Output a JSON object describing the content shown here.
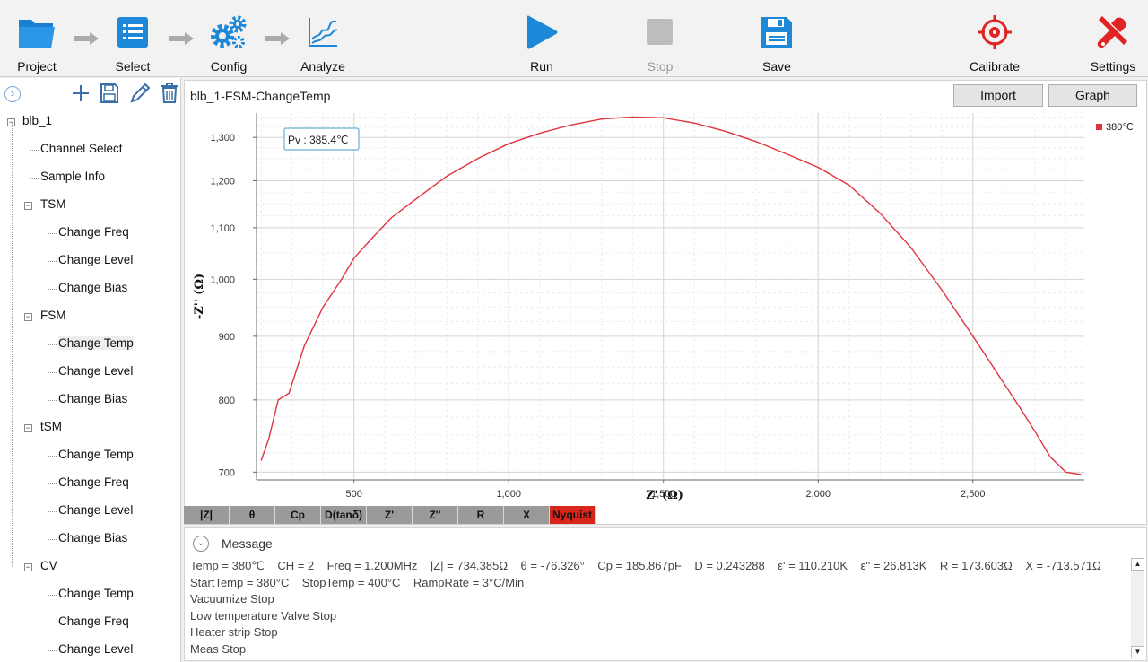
{
  "toolbar": {
    "project": "Project",
    "select": "Select",
    "config": "Config",
    "analyze": "Analyze",
    "run": "Run",
    "stop": "Stop",
    "save": "Save",
    "calibrate": "Calibrate",
    "settings": "Settings"
  },
  "tree": {
    "root": "blb_1",
    "channel_select": "Channel Select",
    "sample_info": "Sample Info",
    "groups": [
      {
        "label": "TSM",
        "items": [
          "Change Freq",
          "Change Level",
          "Change Bias"
        ]
      },
      {
        "label": "FSM",
        "items": [
          "Change Temp",
          "Change Level",
          "Change Bias"
        ]
      },
      {
        "label": "tSM",
        "items": [
          "Change Temp",
          "Change Freq",
          "Change Level",
          "Change Bias"
        ]
      },
      {
        "label": "CV",
        "items": [
          "Change Temp",
          "Change Freq",
          "Change Level"
        ]
      }
    ]
  },
  "graph": {
    "title": "blb_1-FSM-ChangeTemp",
    "import": "Import",
    "graph_btn": "Graph",
    "pv_label": "Pv :  385.4℃"
  },
  "tabs": [
    "|Z|",
    "θ",
    "Cp",
    "D(tanδ)",
    "Z'",
    "Z''",
    "R",
    "X",
    "Nyquist"
  ],
  "message": {
    "title": "Message",
    "lines": [
      "Temp = 380℃    CH = 2    Freq = 1.200MHz    |Z| = 734.385Ω    θ = -76.326°    Cp = 185.867pF    D = 0.243288    ε' = 110.210K    ε'' = 26.813K    R = 173.603Ω    X = -713.571Ω",
      "StartTemp = 380°C    StopTemp = 400°C    RampRate = 3°C/Min",
      "Vacuumize Stop",
      "Low temperature Valve Stop",
      "Heater strip Stop",
      "Meas Stop"
    ]
  },
  "colors": {
    "accent_blue": "#1e88d8",
    "series_red": "#e0333f",
    "active_tab": "#d9261c"
  },
  "chart_data": {
    "type": "line",
    "xlabel": "Z' (Ω)",
    "ylabel": "-Z'' (Ω)",
    "x_ticks": [
      500,
      1000,
      1500,
      2000,
      2500
    ],
    "x_tick_labels": [
      "500",
      "1,000",
      "1,500",
      "2,000",
      "2,500"
    ],
    "y_ticks": [
      700,
      800,
      900,
      1000,
      1100,
      1200,
      1300
    ],
    "y_tick_labels": [
      "700",
      "800",
      "900",
      "1,000",
      "1,100",
      "1,200",
      "1,300"
    ],
    "xlim": [
      185,
      2860
    ],
    "ylim": [
      690,
      1360
    ],
    "y_scale": "log",
    "grid": true,
    "legend": "top-right",
    "series": [
      {
        "name": "380℃",
        "color": "#e0333f",
        "x": [
          200,
          225,
          255,
          290,
          340,
          400,
          460,
          500,
          560,
          620,
          700,
          800,
          900,
          1000,
          1100,
          1200,
          1300,
          1400,
          1500,
          1600,
          1700,
          1800,
          1900,
          2000,
          2100,
          2200,
          2300,
          2400,
          2500,
          2600,
          2650,
          2700,
          2750,
          2800,
          2850
        ],
        "y": [
          715,
          745,
          800,
          810,
          885,
          950,
          1000,
          1040,
          1080,
          1120,
          1160,
          1210,
          1250,
          1285,
          1310,
          1330,
          1345,
          1350,
          1348,
          1335,
          1315,
          1290,
          1260,
          1230,
          1190,
          1130,
          1060,
          980,
          900,
          825,
          790,
          755,
          720,
          700,
          697
        ]
      }
    ]
  }
}
